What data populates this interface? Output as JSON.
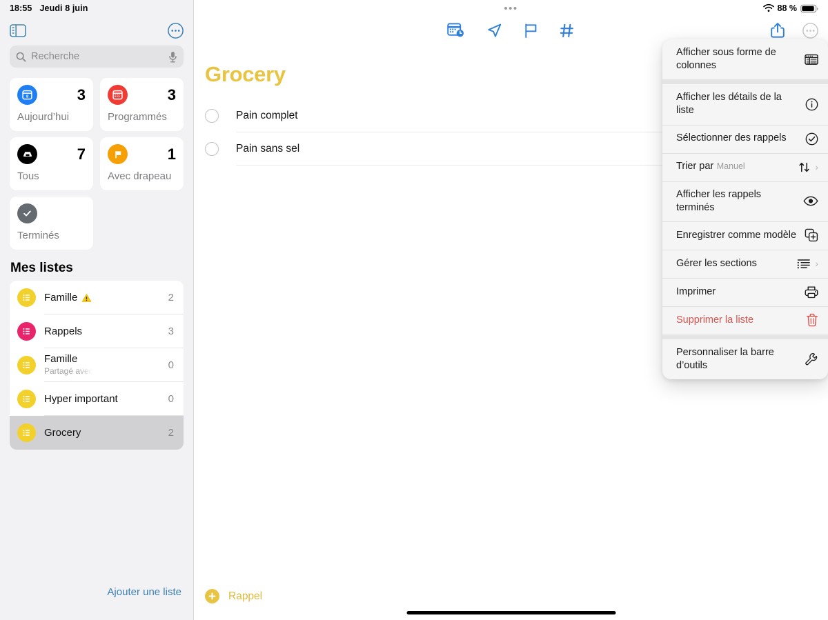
{
  "status_bar": {
    "time": "18:55",
    "date": "Jeudi 8 juin",
    "battery_percent": "88 %",
    "wifi_icon": "wifi-icon",
    "battery_icon": "battery-icon"
  },
  "sidebar": {
    "toggle_icon": "sidebar-toggle-icon",
    "more_icon": "more-circle-icon",
    "search": {
      "placeholder": "Recherche",
      "value": "",
      "search_icon": "search-icon",
      "mic_icon": "microphone-icon"
    },
    "smart_cards": [
      {
        "label": "Aujourd’hui",
        "count": "3",
        "icon": "calendar-day-icon",
        "color": "#1d7ff3",
        "day": "8"
      },
      {
        "label": "Programmés",
        "count": "3",
        "icon": "calendar-icon",
        "color": "#f03b35"
      },
      {
        "label": "Tous",
        "count": "7",
        "icon": "inbox-icon",
        "color": "#000000"
      },
      {
        "label": "Avec drapeau",
        "count": "1",
        "icon": "flag-icon",
        "color": "#f6a007"
      },
      {
        "label": "Terminés",
        "count": "",
        "icon": "checkmark-icon",
        "color": "#646a70"
      }
    ],
    "my_lists_title": "Mes listes",
    "lists": [
      {
        "name": "Famille",
        "subtitle": "",
        "count": "2",
        "color": "#f3d12c",
        "warning_icon": "warning-triangle-icon",
        "selected": false
      },
      {
        "name": "Rappels",
        "subtitle": "",
        "count": "3",
        "color": "#e8246b",
        "warning_icon": "",
        "selected": false
      },
      {
        "name": "Famille",
        "subtitle": "Partagé avec",
        "count": "0",
        "color": "#f3d12c",
        "warning_icon": "",
        "selected": false
      },
      {
        "name": "Hyper important",
        "subtitle": "",
        "count": "0",
        "color": "#f3d12c",
        "warning_icon": "",
        "selected": false
      },
      {
        "name": "Grocery",
        "subtitle": "",
        "count": "2",
        "color": "#f3d12c",
        "warning_icon": "",
        "selected": true
      }
    ],
    "add_list_label": "Ajouter une liste"
  },
  "main": {
    "grabber": "•••",
    "toolbar": {
      "items": [
        {
          "icon": "calendar-clock-icon",
          "name": "add-date-button"
        },
        {
          "icon": "location-arrow-icon",
          "name": "add-location-button"
        },
        {
          "icon": "flag-outline-icon",
          "name": "add-flag-button"
        },
        {
          "icon": "hashtag-icon",
          "name": "add-tag-button"
        }
      ],
      "share_icon": "share-icon",
      "more_icon": "more-circle-icon"
    },
    "list_title": "Grocery",
    "list_title_color": "#e8c443",
    "reminders": [
      {
        "text": "Pain complet",
        "completed": false
      },
      {
        "text": "Pain sans sel",
        "completed": false
      }
    ],
    "add_reminder_label": "Rappel",
    "add_reminder_icon": "plus-circle-icon"
  },
  "context_menu": {
    "groups": [
      {
        "items": [
          {
            "title": "Afficher sous forme de colonnes",
            "subtitle": "",
            "icon": "columns-view-icon",
            "chevron": false,
            "destructive": false
          }
        ]
      },
      {
        "items": [
          {
            "title": "Afficher les détails de la liste",
            "subtitle": "",
            "icon": "info-circle-icon",
            "chevron": false,
            "destructive": false
          },
          {
            "title": "Sélectionner des rappels",
            "subtitle": "",
            "icon": "checkmark-circle-icon",
            "chevron": false,
            "destructive": false
          },
          {
            "title": "Trier par",
            "subtitle": "Manuel",
            "icon": "sort-arrows-icon",
            "chevron": true,
            "destructive": false
          },
          {
            "title": "Afficher les rappels terminés",
            "subtitle": "",
            "icon": "eye-icon",
            "chevron": false,
            "destructive": false
          },
          {
            "title": "Enregistrer comme modèle",
            "subtitle": "",
            "icon": "duplicate-icon",
            "chevron": false,
            "destructive": false
          },
          {
            "title": "Gérer les sections",
            "subtitle": "",
            "icon": "sections-icon",
            "chevron": true,
            "destructive": false
          },
          {
            "title": "Imprimer",
            "subtitle": "",
            "icon": "printer-icon",
            "chevron": false,
            "destructive": false
          },
          {
            "title": "Supprimer la liste",
            "subtitle": "",
            "icon": "trash-icon",
            "chevron": false,
            "destructive": true
          }
        ]
      },
      {
        "items": [
          {
            "title": "Personnaliser la barre d’outils",
            "subtitle": "",
            "icon": "wrench-icon",
            "chevron": false,
            "destructive": false
          }
        ]
      }
    ]
  }
}
